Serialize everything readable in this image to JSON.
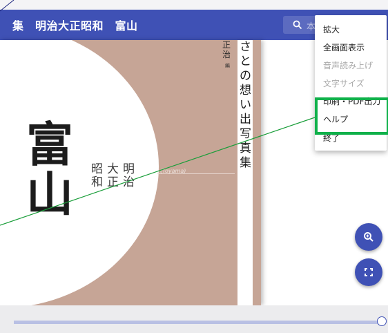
{
  "header": {
    "title": "集　明治大正昭和　富山",
    "search_placeholder": "本"
  },
  "cover": {
    "main_title": "富山",
    "eras": [
      "明治",
      "大正",
      "昭和"
    ],
    "romaji": "(Toyama)",
    "spine_title": "さとの想い出写真集",
    "editor": "正治",
    "editor_suffix": "編"
  },
  "menu": {
    "items": [
      {
        "label": "拡大",
        "enabled": true
      },
      {
        "label": "全画面表示",
        "enabled": true
      },
      {
        "label": "音声読み上げ",
        "enabled": false
      },
      {
        "label": "文字サイズ",
        "enabled": false
      },
      {
        "label": "印刷・PDF出力",
        "enabled": true
      },
      {
        "label": "ヘルプ",
        "enabled": true
      },
      {
        "label": "終了",
        "enabled": true
      }
    ]
  },
  "progress": {
    "value_fraction": 1.0
  },
  "buttons": {
    "zoom_icon": "zoom-in-icon",
    "fullscreen_icon": "fullscreen-icon"
  },
  "colors": {
    "header": "#3f51b5",
    "cover": "#c6a596",
    "highlight": "#0fb14a"
  }
}
